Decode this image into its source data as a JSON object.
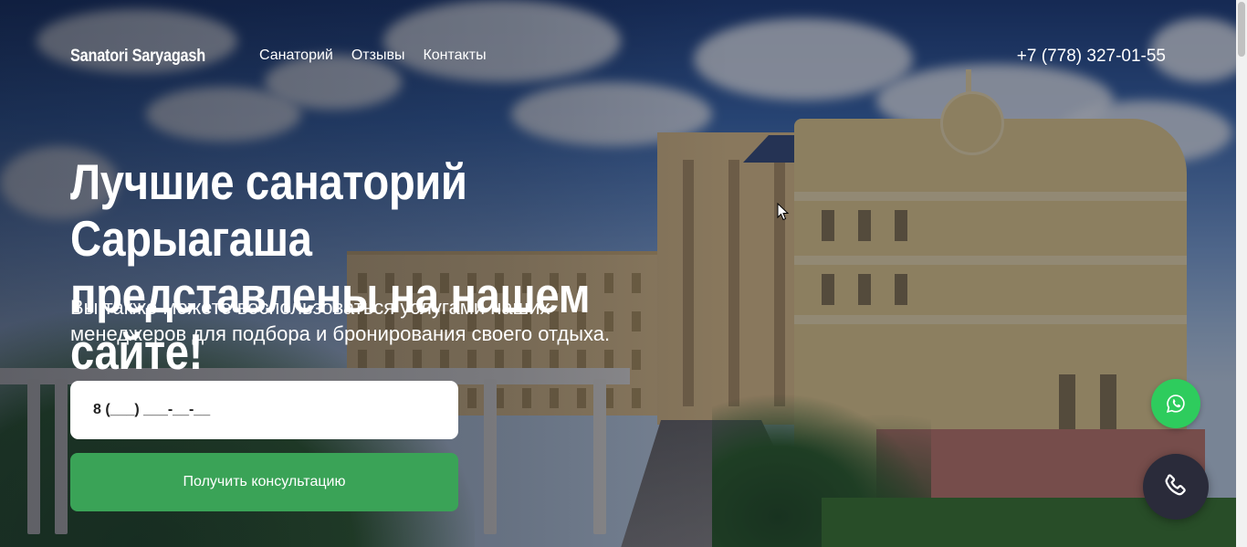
{
  "header": {
    "logo": "Sanatori Saryagash",
    "nav": [
      {
        "label": "Санаторий"
      },
      {
        "label": "Отзывы"
      },
      {
        "label": "Контакты"
      }
    ],
    "phone": "+7 (778) 327-01-55"
  },
  "hero": {
    "title_line1": "Лучшие санаторий Сарыагаша",
    "title_line2": "представлены на нашем сайте!",
    "subtitle_line1": "Вы также можете воспользоваться услугами наших",
    "subtitle_line2": "менеджеров для подбора и бронирования своего отдыха.",
    "phone_input": {
      "value": "8 (___) ___-__-__"
    },
    "submit_label": "Получить консультацию"
  },
  "floating": {
    "whatsapp_icon": "whatsapp-icon",
    "call_icon": "phone-icon",
    "whatsapp_color": "#2ecc5d",
    "call_color": "#2a2b3a"
  },
  "colors": {
    "accent_green": "#3aa357"
  }
}
